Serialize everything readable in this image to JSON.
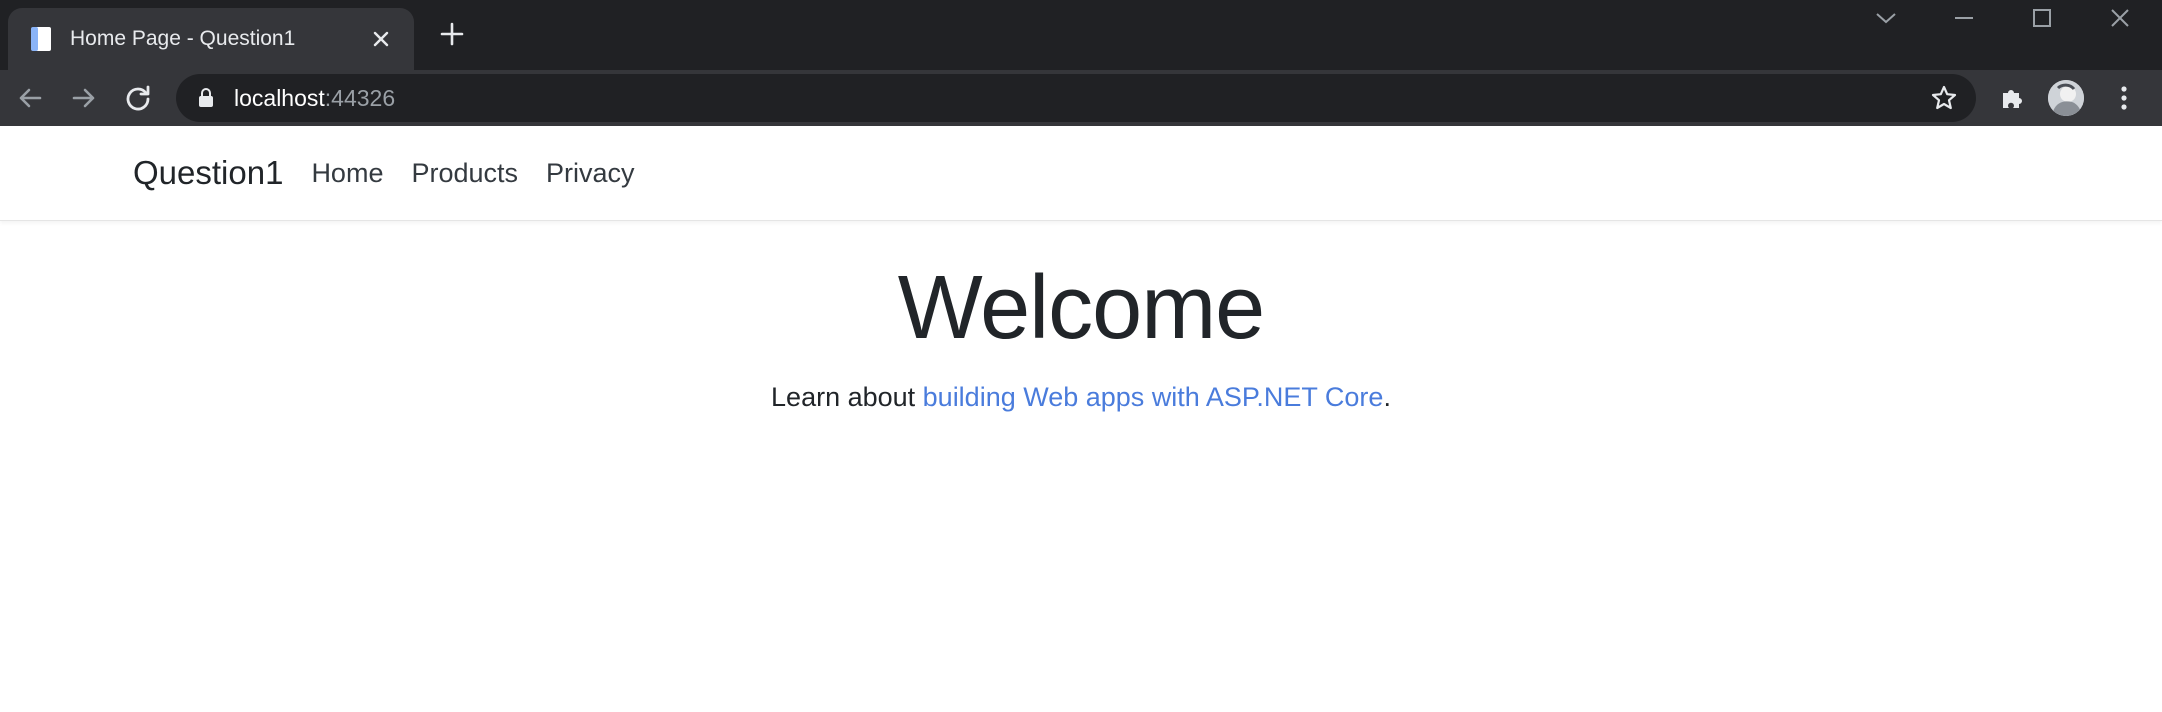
{
  "browser": {
    "tab_title": "Home Page - Question1",
    "url_host": "localhost",
    "url_port": ":44326"
  },
  "site": {
    "brand": "Question1",
    "nav": [
      "Home",
      "Products",
      "Privacy"
    ]
  },
  "main": {
    "heading": "Welcome",
    "lead_prefix": "Learn about ",
    "lead_link": "building Web apps with ASP.NET Core",
    "lead_suffix": "."
  },
  "colors": {
    "link": "#4a7cdc",
    "chrome_dark": "#202124",
    "chrome_tab": "#35363a"
  },
  "icons": [
    "page-icon",
    "close-icon",
    "plus-icon",
    "chevron-down-icon",
    "minimize-icon",
    "maximize-icon",
    "close-window-icon",
    "back-arrow-icon",
    "forward-arrow-icon",
    "reload-icon",
    "lock-icon",
    "star-icon",
    "puzzle-icon",
    "avatar",
    "kebab-menu-icon"
  ]
}
